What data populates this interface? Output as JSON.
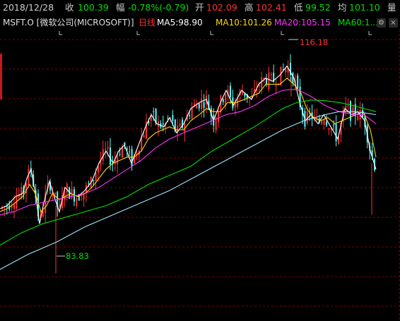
{
  "header": {
    "date": "2018/12/28",
    "close_label": "收",
    "close_value": "100.39",
    "change_label": "幅",
    "change_value": "-0.78%(-0.79)",
    "open_label": "开",
    "open_value": "102.09",
    "high_label": "高",
    "high_value": "102.41",
    "low_label": "低",
    "low_value": "99.52",
    "avg_label": "均",
    "avg_value": "101.10",
    "vol_label": "量"
  },
  "legend": {
    "symbol": "MSFT.O [微软公司(MICROSOFT)]",
    "period": "日线",
    "ma5": "MA5:98.90",
    "ma10": "MA10:101.26",
    "ma20": "MA20:105.15",
    "ma60": "MA60:1..."
  },
  "annotations": {
    "high_marker": "116.18",
    "low_marker": "83.83"
  },
  "colors": {
    "background": "#000000",
    "up": "#ff3232",
    "down": "#54ffff",
    "ma5": "#ffffff",
    "ma10": "#ffd700",
    "ma20": "#ff33ff",
    "ma60": "#00e000",
    "ma_long": "#9ee6ff",
    "grid": "#7a0000"
  },
  "chart_data": {
    "type": "candlestick",
    "y_range": [
      76,
      124
    ],
    "grid": "dashed horizontal",
    "series": [
      {
        "name": "MA5",
        "anchors": [
          [
            0,
            94.5
          ],
          [
            10,
            95
          ],
          [
            22,
            96.5
          ],
          [
            32,
            97
          ],
          [
            38,
            99.5
          ],
          [
            44,
            101
          ],
          [
            50,
            97
          ],
          [
            56,
            92
          ],
          [
            62,
            95.5
          ],
          [
            70,
            99
          ],
          [
            78,
            96
          ],
          [
            84,
            94
          ],
          [
            92,
            98
          ],
          [
            100,
            97
          ],
          [
            110,
            96.5
          ],
          [
            120,
            97.5
          ],
          [
            130,
            99
          ],
          [
            140,
            102
          ],
          [
            150,
            104
          ],
          [
            160,
            102
          ],
          [
            168,
            104
          ],
          [
            176,
            105
          ],
          [
            186,
            102
          ],
          [
            196,
            105
          ],
          [
            206,
            108
          ],
          [
            214,
            110
          ],
          [
            222,
            108.5
          ],
          [
            232,
            108
          ],
          [
            240,
            109.5
          ],
          [
            250,
            107
          ],
          [
            260,
            108.5
          ],
          [
            270,
            111
          ],
          [
            282,
            112
          ],
          [
            292,
            112.5
          ],
          [
            302,
            109
          ],
          [
            312,
            112
          ],
          [
            320,
            114
          ],
          [
            330,
            111.5
          ],
          [
            342,
            114
          ],
          [
            356,
            112.5
          ],
          [
            366,
            115
          ],
          [
            376,
            116
          ],
          [
            386,
            115.5
          ],
          [
            396,
            116.5
          ],
          [
            406,
            118
          ],
          [
            416,
            116
          ],
          [
            424,
            112
          ],
          [
            432,
            109
          ],
          [
            440,
            110
          ],
          [
            450,
            108.5
          ],
          [
            458,
            110
          ],
          [
            468,
            108
          ],
          [
            478,
            106
          ],
          [
            488,
            111
          ],
          [
            498,
            110
          ],
          [
            506,
            110.5
          ],
          [
            516,
            109
          ],
          [
            524,
            104
          ],
          [
            532,
            101
          ]
        ]
      },
      {
        "name": "MA10",
        "anchors": [
          [
            0,
            94
          ],
          [
            10,
            94.5
          ],
          [
            22,
            95.5
          ],
          [
            32,
            96.5
          ],
          [
            42,
            98.5
          ],
          [
            50,
            97
          ],
          [
            58,
            94
          ],
          [
            66,
            95
          ],
          [
            74,
            97
          ],
          [
            84,
            96
          ],
          [
            92,
            96.5
          ],
          [
            100,
            97
          ],
          [
            110,
            96.5
          ],
          [
            120,
            97
          ],
          [
            130,
            98
          ],
          [
            140,
            99.5
          ],
          [
            150,
            101
          ],
          [
            160,
            102
          ],
          [
            170,
            102.5
          ],
          [
            180,
            103
          ],
          [
            190,
            103
          ],
          [
            200,
            104
          ],
          [
            210,
            106
          ],
          [
            220,
            107
          ],
          [
            230,
            107.5
          ],
          [
            240,
            108
          ],
          [
            250,
            107.5
          ],
          [
            260,
            107.5
          ],
          [
            270,
            109
          ],
          [
            282,
            110
          ],
          [
            292,
            111
          ],
          [
            302,
            110.5
          ],
          [
            312,
            110.5
          ],
          [
            322,
            112
          ],
          [
            334,
            112
          ],
          [
            346,
            112.5
          ],
          [
            356,
            113
          ],
          [
            366,
            113.5
          ],
          [
            376,
            115
          ],
          [
            386,
            115
          ],
          [
            396,
            115
          ],
          [
            406,
            116
          ],
          [
            416,
            115
          ],
          [
            426,
            113.5
          ],
          [
            434,
            111
          ],
          [
            444,
            109.5
          ],
          [
            454,
            109
          ],
          [
            464,
            109.5
          ],
          [
            474,
            108.5
          ],
          [
            484,
            109
          ],
          [
            494,
            109.5
          ],
          [
            504,
            110
          ],
          [
            514,
            110.5
          ],
          [
            524,
            107.5
          ],
          [
            532,
            103
          ]
        ]
      },
      {
        "name": "MA20",
        "anchors": [
          [
            0,
            93.5
          ],
          [
            20,
            94
          ],
          [
            40,
            95
          ],
          [
            60,
            95.5
          ],
          [
            80,
            96
          ],
          [
            100,
            96.5
          ],
          [
            120,
            97
          ],
          [
            140,
            98
          ],
          [
            160,
            99.5
          ],
          [
            180,
            101
          ],
          [
            200,
            102.5
          ],
          [
            220,
            104.5
          ],
          [
            240,
            106
          ],
          [
            260,
            107
          ],
          [
            280,
            108
          ],
          [
            300,
            109
          ],
          [
            320,
            110
          ],
          [
            340,
            110.5
          ],
          [
            360,
            111.5
          ],
          [
            380,
            113
          ],
          [
            400,
            114
          ],
          [
            420,
            114.2
          ],
          [
            440,
            113
          ],
          [
            460,
            111.5
          ],
          [
            480,
            110.5
          ],
          [
            500,
            110
          ],
          [
            515,
            110
          ],
          [
            532,
            108.5
          ]
        ]
      },
      {
        "name": "MA60",
        "anchors": [
          [
            0,
            88.5
          ],
          [
            30,
            90.5
          ],
          [
            60,
            92
          ],
          [
            90,
            93
          ],
          [
            120,
            94
          ],
          [
            150,
            95
          ],
          [
            180,
            96.5
          ],
          [
            210,
            98.5
          ],
          [
            240,
            100
          ],
          [
            270,
            101.5
          ],
          [
            300,
            104
          ],
          [
            330,
            106
          ],
          [
            360,
            108
          ],
          [
            380,
            109.5
          ],
          [
            400,
            111
          ],
          [
            420,
            112
          ],
          [
            440,
            112.4
          ],
          [
            460,
            112.3
          ],
          [
            480,
            112
          ],
          [
            500,
            111.5
          ],
          [
            515,
            111
          ],
          [
            532,
            110.5
          ]
        ]
      },
      {
        "name": "MA_LONG",
        "anchors": [
          [
            0,
            84.5
          ],
          [
            40,
            87
          ],
          [
            80,
            89
          ],
          [
            120,
            91.5
          ],
          [
            160,
            93.5
          ],
          [
            200,
            95.5
          ],
          [
            240,
            97.5
          ],
          [
            280,
            100
          ],
          [
            320,
            102.5
          ],
          [
            360,
            105
          ],
          [
            400,
            107.5
          ],
          [
            430,
            109
          ],
          [
            460,
            110
          ],
          [
            480,
            110.5
          ],
          [
            500,
            110.5
          ],
          [
            515,
            110.3
          ],
          [
            532,
            110
          ]
        ]
      }
    ]
  }
}
